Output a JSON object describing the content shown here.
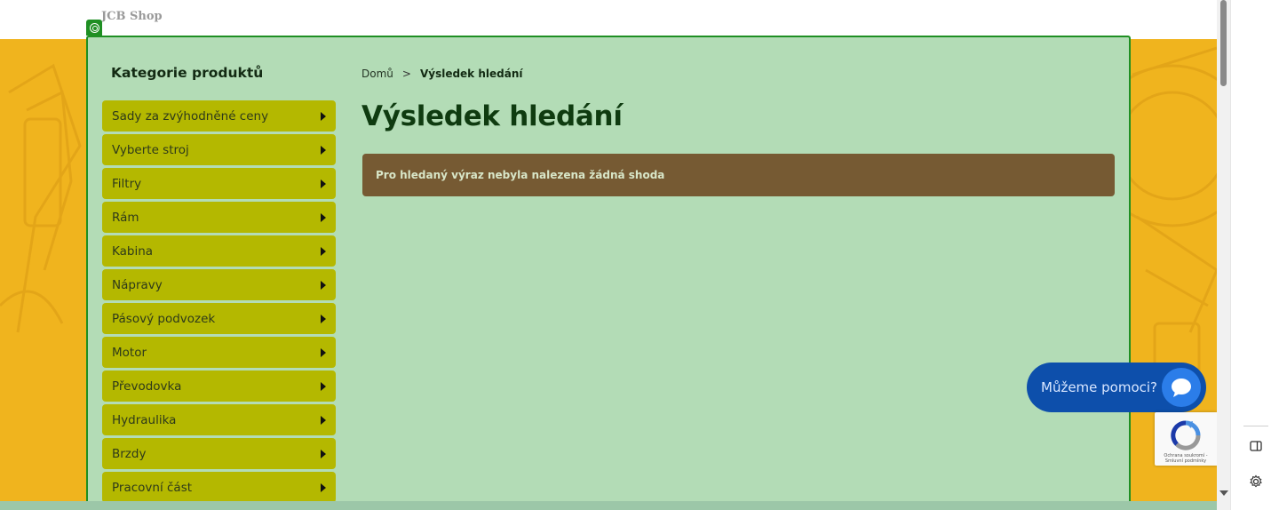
{
  "header": {
    "shop_title": "JCB Shop"
  },
  "sidebar": {
    "title": "Kategorie produktů",
    "items": [
      {
        "label": "Sady za zvýhodněné ceny"
      },
      {
        "label": "Vyberte stroj"
      },
      {
        "label": "Filtry"
      },
      {
        "label": "Rám"
      },
      {
        "label": "Kabina"
      },
      {
        "label": "Nápravy"
      },
      {
        "label": "Pásový podvozek"
      },
      {
        "label": "Motor"
      },
      {
        "label": "Převodovka"
      },
      {
        "label": "Hydraulika"
      },
      {
        "label": "Brzdy"
      },
      {
        "label": "Pracovní část"
      }
    ]
  },
  "breadcrumb": {
    "home": "Domů",
    "separator": ">",
    "current": "Výsledek hledání"
  },
  "main": {
    "title": "Výsledek hledání",
    "notice": "Pro hledaný výraz nebyla nalezena žádná shoda"
  },
  "chat": {
    "label": "Můžeme pomoci?"
  },
  "recaptcha": {
    "footer": "Ochrana soukromí - Smluvní podmínky"
  },
  "colors": {
    "banner": "#f0b41e",
    "overlay": "#b3dcb6",
    "overlay_border": "#1f8f23",
    "category_item": "#b4b800",
    "notice_bg": "#765a33",
    "chat_bg": "#0d4fab"
  },
  "icons": {
    "category_arrow": "caret-right-icon",
    "chat": "speech-bubble-icon",
    "overlay_marker": "target-icon",
    "panel_top": "sidebar-toggle-icon",
    "panel_bottom": "gear-icon"
  }
}
